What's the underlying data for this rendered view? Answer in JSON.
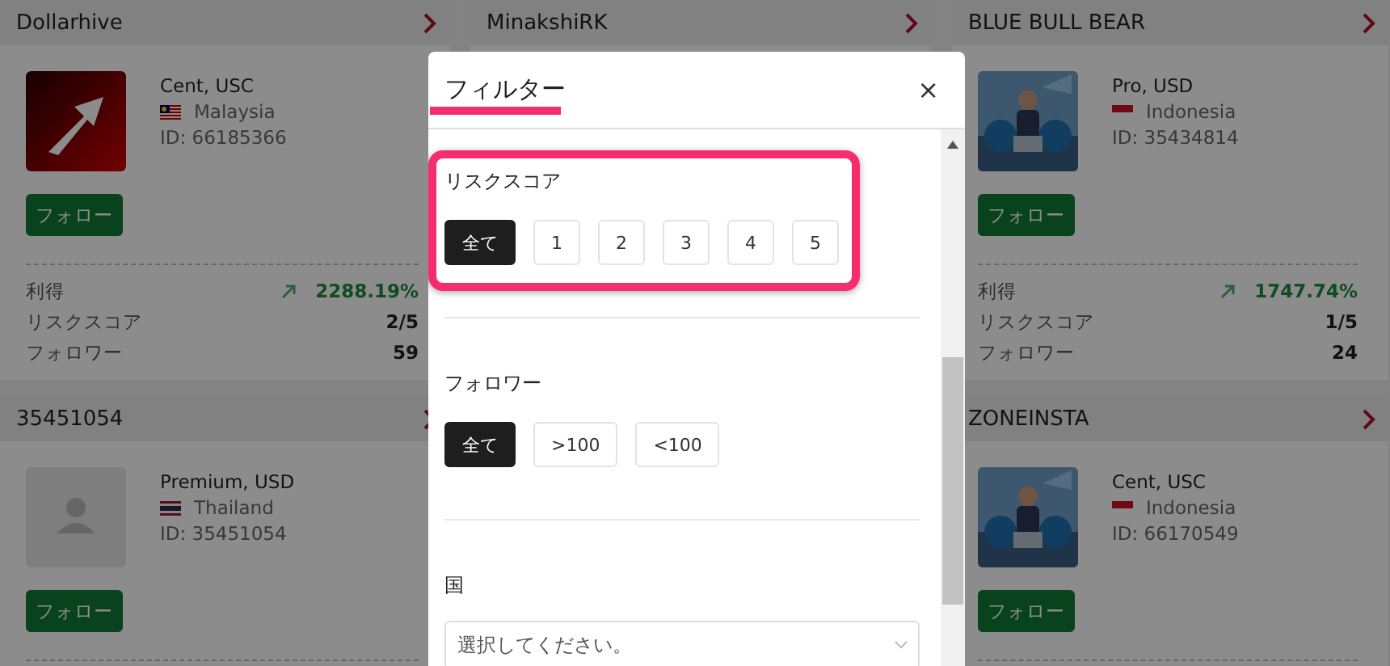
{
  "columns": [
    {
      "cards": [
        {
          "name": "Dollarhive",
          "avatar": {
            "kind": "logo"
          },
          "account": "Cent, USC",
          "country": {
            "kind": "malaysia",
            "name": "Malaysia"
          },
          "id": "ID: 66185366",
          "follow": "フォロー",
          "stats": [
            {
              "kind": "gain",
              "label": "利得",
              "value": "2288.19%"
            },
            {
              "kind": "plain",
              "label": "リスクスコア",
              "value": "2/5"
            },
            {
              "kind": "plain",
              "label": "フォロワー",
              "value": "59"
            }
          ]
        },
        {
          "name": "35451054",
          "avatar": {
            "kind": "placeholder"
          },
          "account": "Premium, USD",
          "country": {
            "kind": "thailand",
            "name": "Thailand"
          },
          "id": "ID: 35451054",
          "follow": "フォロー"
        }
      ]
    },
    {
      "cards": [
        {
          "name": "MinakshiRK"
        }
      ]
    },
    {
      "cards": [
        {
          "name": "BLUE BULL BEAR",
          "account": "Pro, USD",
          "country": {
            "kind": "indonesia",
            "name": "Indonesia"
          },
          "id": "ID: 35434814",
          "follow": "フォロー",
          "stats": [
            {
              "kind": "gain",
              "label": "利得",
              "value": "1747.74%"
            },
            {
              "kind": "plain",
              "label": "リスクスコア",
              "value": "1/5"
            },
            {
              "kind": "plain",
              "label": "フォロワー",
              "value": "24"
            }
          ]
        },
        {
          "name": "ZONEINSTA",
          "account": "Cent, USC",
          "country": {
            "kind": "indonesia",
            "name": "Indonesia"
          },
          "id": "ID: 66170549",
          "follow": "フォロー"
        }
      ]
    }
  ],
  "filter_modal": {
    "title": "フィルター",
    "close": "×",
    "sections": [
      {
        "kind": "buttons",
        "label": "リスクスコア",
        "highlighted": true,
        "options": [
          {
            "label": "全て",
            "selected": true
          },
          {
            "label": "1",
            "selected": false
          },
          {
            "label": "2",
            "selected": false
          },
          {
            "label": "3",
            "selected": false
          },
          {
            "label": "4",
            "selected": false
          },
          {
            "label": "5",
            "selected": false
          }
        ]
      },
      {
        "kind": "buttons",
        "label": "フォロワー",
        "highlighted": false,
        "options": [
          {
            "label": "全て",
            "selected": true
          },
          {
            "label": ">100",
            "selected": false
          },
          {
            "label": "<100",
            "selected": false
          }
        ]
      },
      {
        "kind": "select",
        "label": "国",
        "placeholder": "選択してください。"
      }
    ]
  }
}
